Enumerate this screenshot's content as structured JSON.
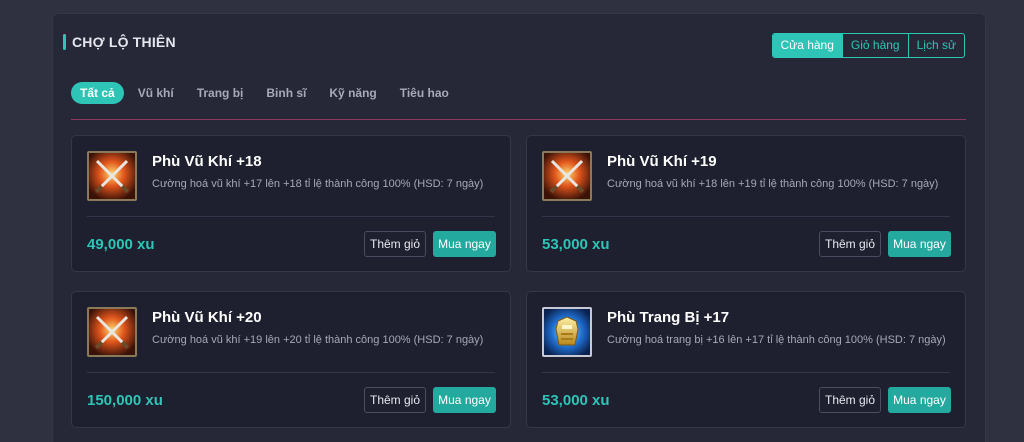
{
  "header": {
    "title": "CHỢ LỘ THIÊN"
  },
  "top_tabs": [
    {
      "label": "Cửa hàng",
      "active": true
    },
    {
      "label": "Giỏ hàng",
      "active": false
    },
    {
      "label": "Lịch sử",
      "active": false
    }
  ],
  "categories": [
    {
      "label": "Tất cả",
      "active": true
    },
    {
      "label": "Vũ khí",
      "active": false
    },
    {
      "label": "Trang bị",
      "active": false
    },
    {
      "label": "Binh sĩ",
      "active": false
    },
    {
      "label": "Kỹ năng",
      "active": false
    },
    {
      "label": "Tiêu hao",
      "active": false
    }
  ],
  "products": [
    {
      "title": "Phù Vũ Khí +18",
      "desc": "Cường hoá vũ khí +17 lên +18 tỉ lệ thành công 100% (HSD: 7 ngày)",
      "price": "49,000 xu",
      "icon": "crossed-swords-icon",
      "add_label": "Thêm giỏ",
      "buy_label": "Mua ngay"
    },
    {
      "title": "Phù Vũ Khí +19",
      "desc": "Cường hoá vũ khí +18 lên +19 tỉ lệ thành công 100% (HSD: 7 ngày)",
      "price": "53,000 xu",
      "icon": "crossed-swords-icon",
      "add_label": "Thêm giỏ",
      "buy_label": "Mua ngay"
    },
    {
      "title": "Phù Vũ Khí +20",
      "desc": "Cường hoá vũ khí +19 lên +20 tỉ lệ thành công 100% (HSD: 7 ngày)",
      "price": "150,000 xu",
      "icon": "crossed-swords-icon",
      "add_label": "Thêm giỏ",
      "buy_label": "Mua ngay"
    },
    {
      "title": "Phù Trang Bị +17",
      "desc": "Cường hoá trang bị +16 lên +17 tỉ lệ thành công 100% (HSD: 7 ngày)",
      "price": "53,000 xu",
      "icon": "golden-armor-icon",
      "add_label": "Thêm giỏ",
      "buy_label": "Mua ngay"
    }
  ],
  "colors": {
    "accent": "#2ec4b6",
    "buy": "#23a99d",
    "divider": "#8a3a5e"
  }
}
